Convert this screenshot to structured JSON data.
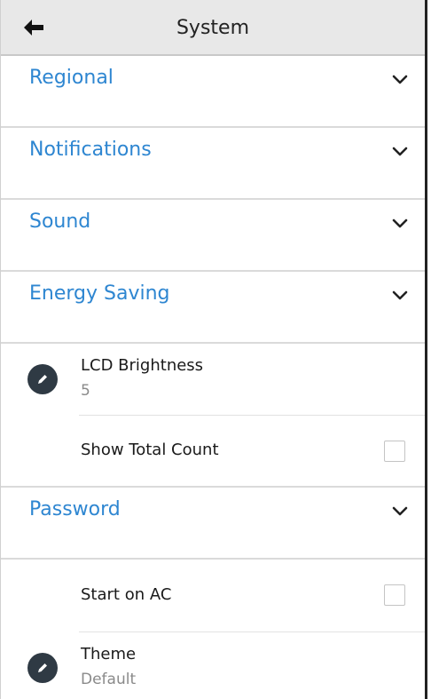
{
  "header": {
    "title": "System",
    "back_icon": "arrow-left-icon"
  },
  "sections": [
    {
      "label": "Regional",
      "icon": "chevron-down-icon"
    },
    {
      "label": "Notifications",
      "icon": "chevron-down-icon"
    },
    {
      "label": "Sound",
      "icon": "chevron-down-icon"
    },
    {
      "label": "Energy Saving",
      "icon": "chevron-down-icon"
    },
    {
      "label": "Password",
      "icon": "chevron-down-icon"
    }
  ],
  "energy_items": {
    "lcd_brightness": {
      "title": "LCD Brightness",
      "value": "5",
      "icon": "pencil-icon"
    },
    "show_total_count": {
      "title": "Show Total Count",
      "checked": false
    }
  },
  "password_items": {
    "start_on_ac": {
      "title": "Start on AC",
      "checked": false
    },
    "theme": {
      "title": "Theme",
      "value": "Default",
      "icon": "pencil-icon"
    }
  },
  "colors": {
    "accent": "#2e86d1",
    "header_bg": "#e8e8e8",
    "icon_bg": "#2f3a44"
  }
}
